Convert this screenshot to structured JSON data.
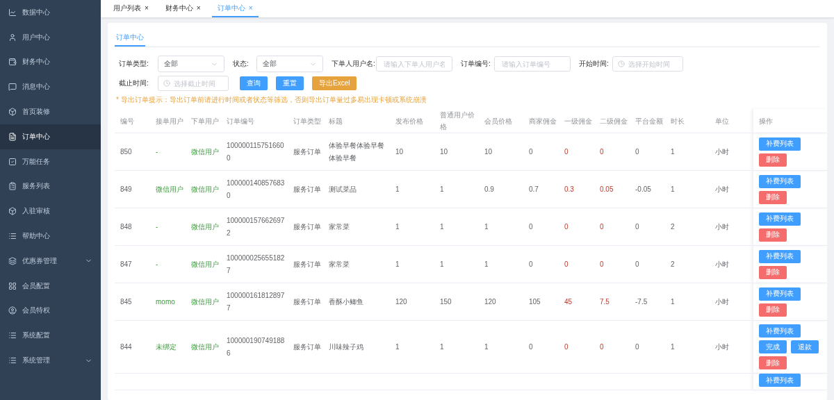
{
  "sidebar": {
    "items": [
      {
        "label": "数据中心",
        "kind": "link",
        "selected": false
      },
      {
        "label": "用户中心",
        "kind": "link",
        "selected": false
      },
      {
        "label": "财务中心",
        "kind": "link",
        "selected": false
      },
      {
        "label": "消息中心",
        "kind": "link",
        "selected": false
      },
      {
        "label": "首页装修",
        "kind": "link",
        "selected": false
      },
      {
        "label": "订单中心",
        "kind": "link",
        "selected": true
      },
      {
        "label": "万能任务",
        "kind": "link",
        "selected": false
      },
      {
        "label": "服务列表",
        "kind": "link",
        "selected": false
      },
      {
        "label": "入驻审核",
        "kind": "link",
        "selected": false
      },
      {
        "label": "帮助中心",
        "kind": "link",
        "selected": false
      },
      {
        "label": "优惠券管理",
        "kind": "group",
        "selected": false,
        "expanded": false
      },
      {
        "label": "会员配置",
        "kind": "link",
        "selected": false
      },
      {
        "label": "会员特权",
        "kind": "link",
        "selected": false
      },
      {
        "label": "系统配置",
        "kind": "link",
        "selected": false
      },
      {
        "label": "系统管理",
        "kind": "group",
        "selected": false,
        "expanded": false
      }
    ]
  },
  "tabs": [
    {
      "label": "用户列表",
      "selected": false,
      "close": "×"
    },
    {
      "label": "财务中心",
      "selected": false,
      "close": "×"
    },
    {
      "label": "订单中心",
      "selected": true,
      "close": "×"
    }
  ],
  "page_tabs": [
    {
      "label": "订单中心",
      "selected": true
    }
  ],
  "filters": [
    {
      "kind": "select",
      "label": "订单类型:",
      "value": "全部"
    },
    {
      "kind": "select",
      "label": "状态:",
      "value": "全部"
    },
    {
      "kind": "input",
      "label": "下单人用户名:",
      "placeholder": "请输入下单人用户名"
    },
    {
      "kind": "input",
      "label": "订单编号:",
      "placeholder": "请输入订单编号"
    },
    {
      "kind": "date",
      "label": "开始时间:",
      "placeholder": "选择开始时间"
    },
    {
      "kind": "date",
      "label": "截止时间:",
      "placeholder": "选择截止时间"
    }
  ],
  "buttons": [
    {
      "label": "查询",
      "kind": "primary"
    },
    {
      "label": "重置",
      "kind": "primary"
    },
    {
      "label": "导出Excel",
      "kind": "warning"
    }
  ],
  "notice": "* 导出订单提示：导出订单前请进行时间或者状态等筛选，否则导出订单量过多易出现卡顿或系统崩溃",
  "table": {
    "columns": [
      {
        "label": "编号",
        "kind": "plain"
      },
      {
        "label": "接单用户",
        "kind": "user"
      },
      {
        "label": "下单用户",
        "kind": "user"
      },
      {
        "label": "订单编号",
        "kind": "plain"
      },
      {
        "label": "订单类型",
        "kind": "plain"
      },
      {
        "label": "标题",
        "kind": "plain"
      },
      {
        "label": "发布价格",
        "kind": "plain"
      },
      {
        "label": "普通用户价格",
        "kind": "plain"
      },
      {
        "label": "会员价格",
        "kind": "plain"
      },
      {
        "label": "商家佣金",
        "kind": "plain"
      },
      {
        "label": "一级佣金",
        "kind": "money"
      },
      {
        "label": "二级佣金",
        "kind": "money"
      },
      {
        "label": "平台金额",
        "kind": "plain"
      },
      {
        "label": "时长",
        "kind": "plain"
      },
      {
        "label": "单位",
        "kind": "plain"
      }
    ],
    "action_header": "操作",
    "rows": [
      {
        "cells": [
          "850",
          "-",
          "微信用户",
          "1000001157516600",
          "服务订单",
          "体验早餐体验早餐体验早餐",
          "10",
          "10",
          "10",
          "0",
          "0",
          "0",
          "0",
          "1",
          "小时"
        ],
        "actions": [
          {
            "label": "补费列表",
            "kind": "primary"
          },
          {
            "label": "删除",
            "kind": "danger"
          }
        ]
      },
      {
        "cells": [
          "849",
          "微信用户",
          "微信用户",
          "1000001408576830",
          "服务订单",
          "测试菜品",
          "1",
          "1",
          "0.9",
          "0.7",
          "0.3",
          "0.05",
          "-0.05",
          "1",
          "小时"
        ],
        "actions": [
          {
            "label": "补费列表",
            "kind": "primary"
          },
          {
            "label": "删除",
            "kind": "danger"
          }
        ]
      },
      {
        "cells": [
          "848",
          "-",
          "微信用户",
          "1000001576626972",
          "服务订单",
          "家常菜",
          "1",
          "1",
          "1",
          "0",
          "0",
          "0",
          "0",
          "2",
          "小时"
        ],
        "actions": [
          {
            "label": "补费列表",
            "kind": "primary"
          },
          {
            "label": "删除",
            "kind": "danger"
          }
        ]
      },
      {
        "cells": [
          "847",
          "-",
          "微信用户",
          "1000000256551827",
          "服务订单",
          "家常菜",
          "1",
          "1",
          "1",
          "0",
          "0",
          "0",
          "0",
          "2",
          "小时"
        ],
        "actions": [
          {
            "label": "补费列表",
            "kind": "primary"
          },
          {
            "label": "删除",
            "kind": "danger"
          }
        ]
      },
      {
        "cells": [
          "845",
          "momo",
          "微信用户",
          "1000001618128977",
          "服务订单",
          "香酥小鲫鱼",
          "120",
          "150",
          "120",
          "105",
          "45",
          "7.5",
          "-7.5",
          "1",
          "小时"
        ],
        "actions": [
          {
            "label": "补费列表",
            "kind": "primary"
          },
          {
            "label": "删除",
            "kind": "danger"
          }
        ]
      },
      {
        "cells": [
          "844",
          "未绑定",
          "微信用户",
          "1000001907491886",
          "服务订单",
          "川味辣子鸡",
          "1",
          "1",
          "1",
          "0",
          "0",
          "0",
          "0",
          "1",
          "小时"
        ],
        "actions": [
          {
            "label": "补费列表",
            "kind": "primary"
          },
          {
            "label": "完成",
            "kind": "primary"
          },
          {
            "label": "退款",
            "kind": "primary"
          },
          {
            "label": "删除",
            "kind": "danger"
          }
        ]
      },
      {
        "cells": [],
        "actions": [
          {
            "label": "补费列表",
            "kind": "primary"
          }
        ]
      }
    ]
  }
}
